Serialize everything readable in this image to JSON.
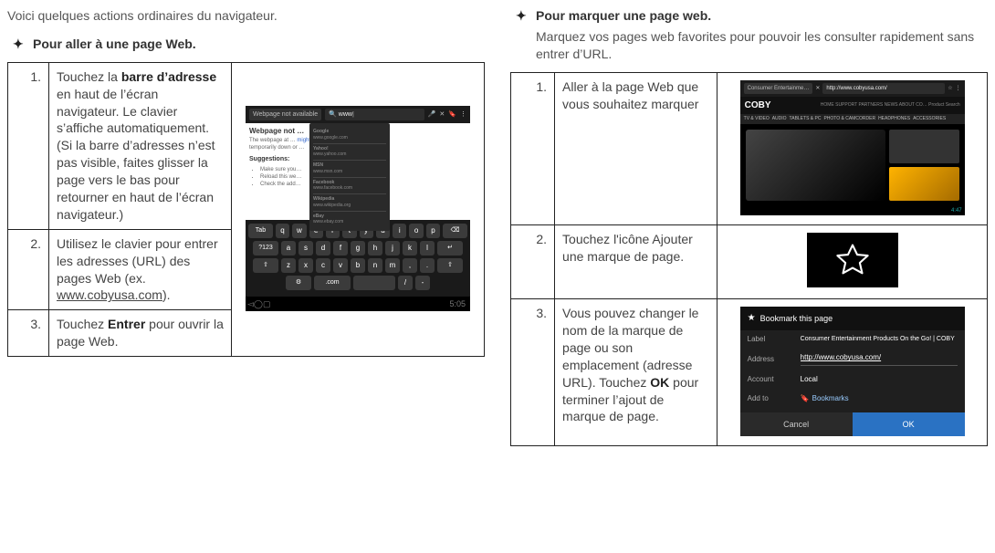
{
  "left": {
    "intro": "Voici quelques actions ordinaires du navigateur.",
    "section_title": "Pour aller à une page Web.",
    "steps": {
      "s1_num": "1.",
      "s1_a": "Touchez la ",
      "s1_b_bold": "barre d’adresse",
      "s1_c": " en haut de l’écran navigateur. Le clavier s’affiche automatiquement. (Si la barre d’adresses n’est pas visible, faites glisser la page vers le bas pour retourner en haut de l’écran navigateur.)",
      "s2_num": "2.",
      "s2_a": "Utilisez le clavier pour entrer les adresses (URL) des pages Web (ex. ",
      "s2_b_under": "www.cobyusa.com",
      "s2_c": ").",
      "s3_num": "3.",
      "s3_a": "Touchez ",
      "s3_b_bold": "Entrer",
      "s3_c": " pour ouvrir la page Web."
    },
    "mock": {
      "tab_label": "Webpage not available",
      "url_value": "www",
      "page_heading": "Webpage not …",
      "page_line1": "The webpage at …",
      "page_line2": "temporarily down or …",
      "page_tail": " might be",
      "sugg_title": "Suggestions:",
      "sugg1": "Make sure you…",
      "sugg2": "Reload this we…",
      "sugg3": "Check the add…",
      "dd1": "Google",
      "dd1u": "www.google.com",
      "dd2": "Yahoo!",
      "dd2u": "www.yahoo.com",
      "dd3": "MSN",
      "dd3u": "www.msn.com",
      "dd4": "Facebook",
      "dd4u": "www.facebook.com",
      "dd5": "Wikipedia",
      "dd5u": "www.wikipedia.org",
      "dd6": "eBay",
      "dd6u": "www.ebay.com",
      "k_tab": "Tab",
      "k_r1": [
        "q",
        "w",
        "e",
        "r",
        "t",
        "y",
        "u",
        "i",
        "o",
        "p"
      ],
      "k_back": "⌫",
      "k_123": "?123",
      "k_r2": [
        "a",
        "s",
        "d",
        "f",
        "g",
        "h",
        "j",
        "k",
        "l"
      ],
      "k_r3": [
        "z",
        "x",
        "c",
        "v",
        "b",
        "n",
        "m",
        ",",
        "."
      ],
      "k_opt": "⚙",
      "k_com": ".com",
      "k_slash": "/",
      "k_dash": "-",
      "time": "5:05",
      "mic": "🎤",
      "x": "✕",
      "bk": "🔖",
      "menu": "⋮"
    }
  },
  "right": {
    "section_title": "Pour marquer une page web.",
    "section_sub": "Marquez vos pages web favorites pour pouvoir les consulter rapidement sans entrer d’URL.",
    "steps": {
      "s1_num": "1.",
      "s1": "Aller à la page Web que vous souhaitez marquer",
      "s2_num": "2.",
      "s2": "Touchez l'icône Ajouter une marque de page.",
      "s3_num": "3.",
      "s3_a": "Vous pouvez changer le nom de la marque de page ou son emplacement (adresse URL). Touchez ",
      "s3_b_bold": "OK",
      "s3_c": " pour terminer l’ajout de marque de page."
    },
    "coby": {
      "tab_label": "Consumer Entertainme…",
      "url_value": "http://www.cobyusa.com/",
      "logo": "COBY",
      "top_links": "HOME  SUPPORT  PARTNERS  NEWS  ABOUT CO…  Product Search",
      "nav": [
        "TV & VIDEO",
        "AUDIO",
        "TABLETS & PC",
        "PHOTO & CAMCORDER",
        "HEADPHONES",
        "ACCESSORIES"
      ],
      "time": "4:47",
      "star": "☆",
      "x": "✕",
      "menu": "⋮"
    },
    "dialog": {
      "title": "Bookmark this page",
      "label_lbl": "Label",
      "label_val": "Consumer Entertainment Products On the Go! | COBY",
      "addr_lbl": "Address",
      "addr_val": "http://www.cobyusa.com/",
      "acct_lbl": "Account",
      "acct_val": "Local",
      "addto_lbl": "Add to",
      "addto_val": "Bookmarks",
      "cancel": "Cancel",
      "ok": "OK"
    }
  }
}
